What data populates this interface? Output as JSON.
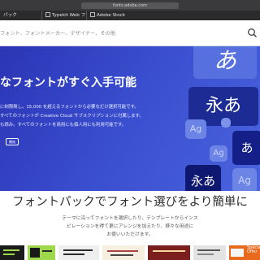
{
  "browser": {
    "address": "fonts.adobe.com",
    "tabs": [
      "パック",
      "Typekit Web フォント",
      "Adobe Stock"
    ]
  },
  "search": {
    "placeholder": "フォント、フォントメーカー、デザイナー、その他"
  },
  "hero": {
    "title": "なフォントがすぐ入手可能",
    "lines": [
      "に制限無し。15,000 を超えるフォントから必要なだけ選択可能です。",
      "すべてのフォントが Creative Cloud サブスクリプションに付属します。",
      "も読み。すべてのフォントを商用にも個人用にも利用可能です。"
    ],
    "button_label": "開始",
    "tiles": {
      "top": "あ",
      "mid": "永あ",
      "ag": "Ag",
      "ag2": "Ag",
      "mid2": "あ",
      "bottom": "永あ",
      "ag3": "Ag"
    }
  },
  "section": {
    "title": "フォントパックでフォント選びをより簡単に",
    "lines": [
      "テーマに沿ってフォントを選択したり、テンプレートからインス",
      "ピレーションを得て更にアレンジを加えたり、様々な用途に",
      "お使いいただけます。"
    ]
  },
  "thumbnails": {
    "items": [
      "",
      "",
      "",
      "",
      "",
      "",
      "Special Offer"
    ]
  },
  "colors": {
    "hero_bg": "#3a4fd0",
    "chrome_bg": "#2b2b2d"
  }
}
